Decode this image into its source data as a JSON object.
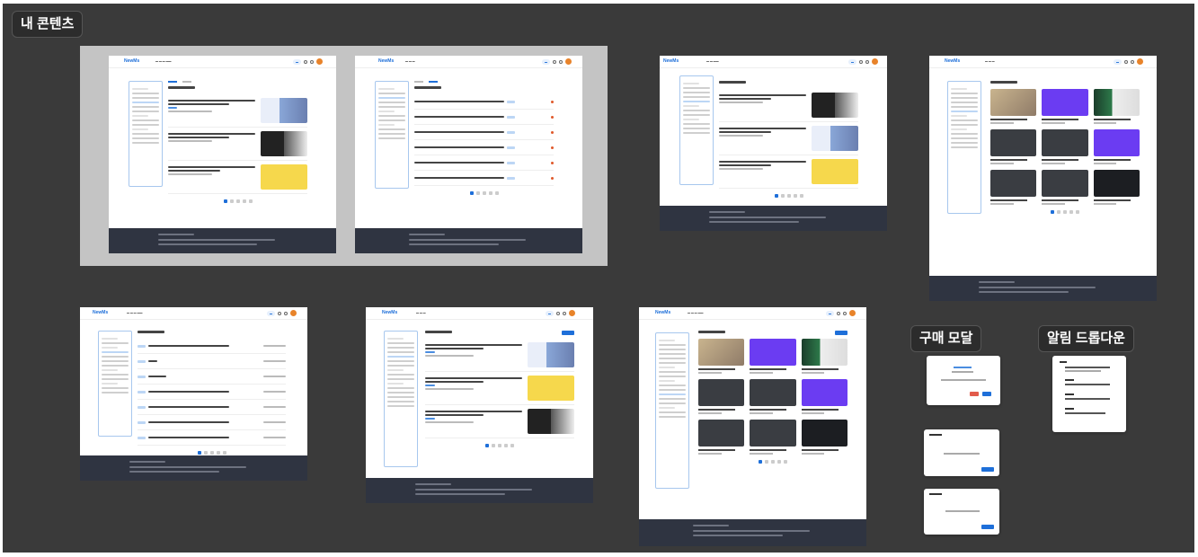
{
  "section_title": "내 콘텐츠",
  "modal_section_label": "구매 모달",
  "dropdown_section_label": "알림 드롭다운",
  "app": {
    "logo": "NewMs"
  },
  "colors": {
    "canvas": "#3a3a3a",
    "accent": "#1e6fd9",
    "footer": "#2f3441",
    "avatar": "#e8832a"
  },
  "icons": [
    "search-icon",
    "bell-icon",
    "avatar"
  ]
}
